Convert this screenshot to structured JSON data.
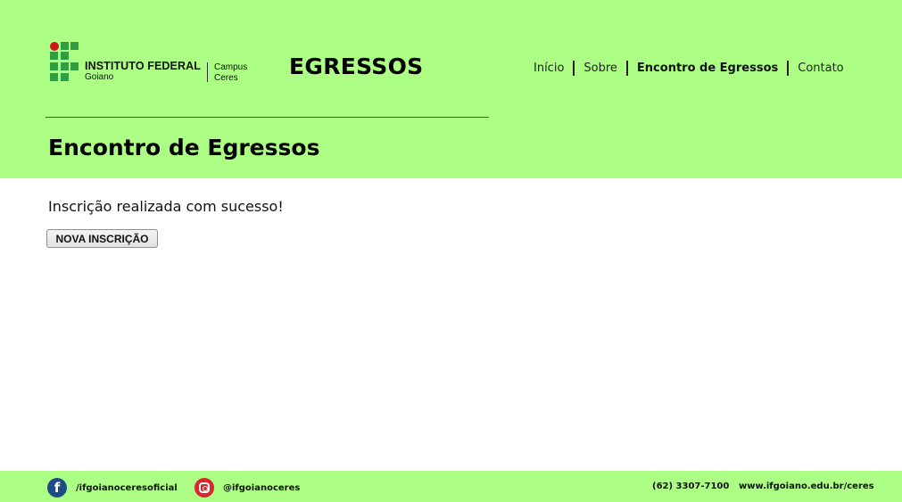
{
  "header": {
    "logo": {
      "name": "INSTITUTO FEDERAL",
      "sub": "Goiano",
      "campus_line1": "Campus",
      "campus_line2": "Ceres"
    },
    "site_title": "EGRESSOS",
    "nav": [
      {
        "label": "Início",
        "active": false
      },
      {
        "label": "Sobre",
        "active": false
      },
      {
        "label": "Encontro de Egressos",
        "active": true
      },
      {
        "label": "Contato",
        "active": false
      }
    ],
    "page_title": "Encontro de Egressos"
  },
  "main": {
    "message": "Inscrição realizada com sucesso!",
    "button_label": "NOVA INSCRIÇÃO"
  },
  "footer": {
    "facebook": {
      "icon": "facebook-icon",
      "label": "/ifgoianoceresoficial"
    },
    "instagram": {
      "icon": "instagram-icon",
      "label": "@ifgoianoceres"
    },
    "phone": "(62) 3307-7100",
    "website": "www.ifgoiano.edu.br/ceres"
  },
  "colors": {
    "header_bg": "#acff84",
    "logo_green": "#2f9e41",
    "logo_red": "#cd191e",
    "facebook_blue": "#1f4c85",
    "instagram_red": "#d8282e"
  }
}
